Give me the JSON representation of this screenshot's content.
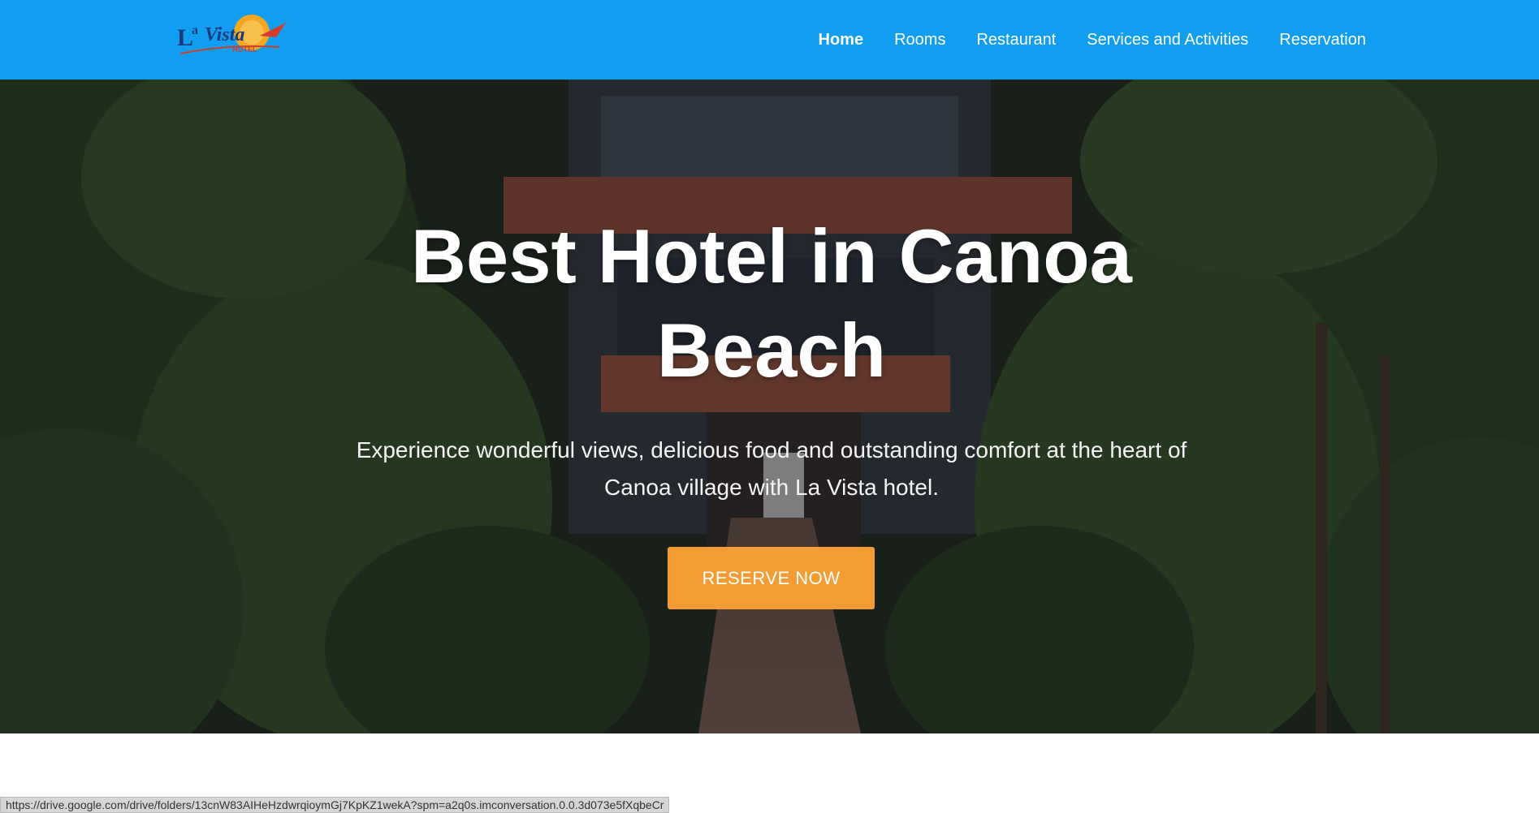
{
  "header": {
    "logo_text": "La Vista HOTEL",
    "nav": [
      {
        "label": "Home",
        "active": true
      },
      {
        "label": "Rooms",
        "active": false
      },
      {
        "label": "Restaurant",
        "active": false
      },
      {
        "label": "Services and Activities",
        "active": false
      },
      {
        "label": "Reservation",
        "active": false
      }
    ]
  },
  "hero": {
    "title_line1": "Best Hotel in Canoa",
    "title_line2": "Beach",
    "subtitle_line1": "Experience wonderful views, delicious food and outstanding comfort at the heart of",
    "subtitle_line2": "Canoa village with La Vista hotel.",
    "cta_label": "RESERVE NOW"
  },
  "status_bar": {
    "url": "https://drive.google.com/drive/folders/13cnW83AIHeHzdwrqioymGj7KpKZ1wekA?spm=a2q0s.imconversation.0.0.3d073e5fXqbeCr"
  },
  "colors": {
    "header_bg": "#129ef0",
    "cta_bg": "#f39c33",
    "text": "#ffffff"
  }
}
